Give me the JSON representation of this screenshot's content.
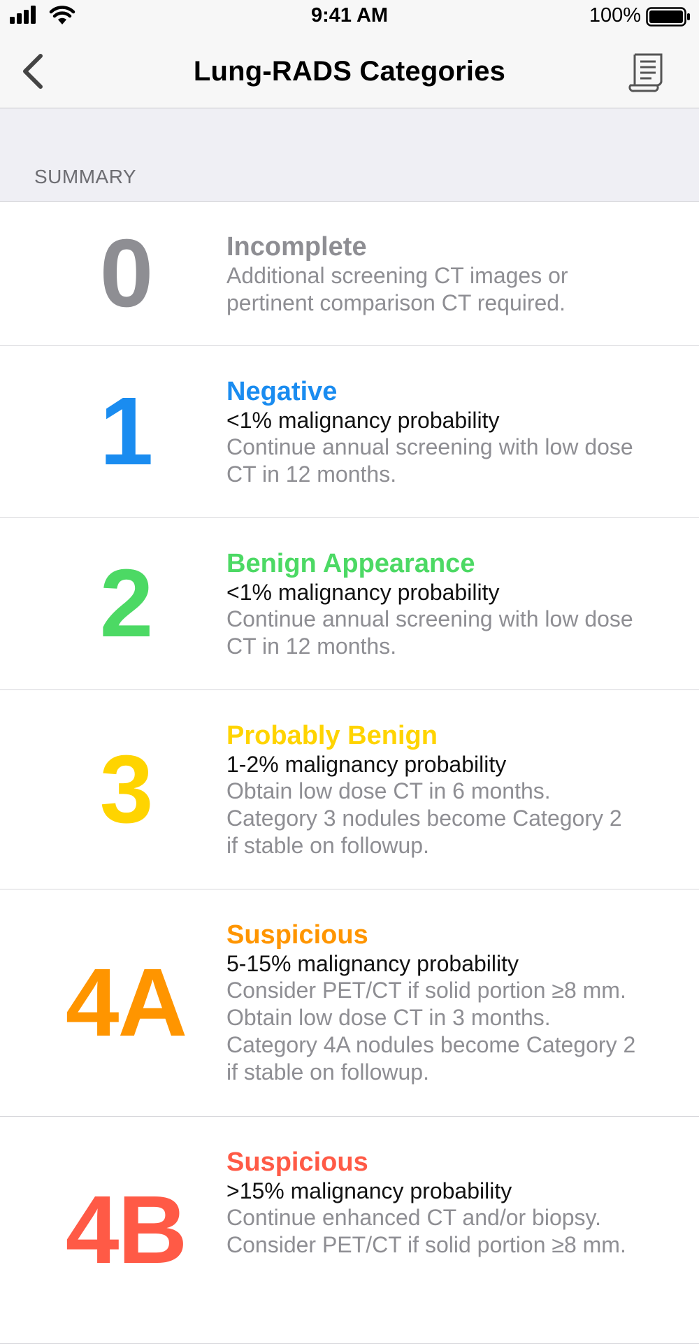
{
  "status_bar": {
    "time": "9:41 AM",
    "battery": "100%"
  },
  "nav": {
    "title": "Lung-RADS Categories"
  },
  "section": {
    "label": "SUMMARY"
  },
  "rows": [
    {
      "num": "0",
      "color": "#8e8e93",
      "title": "Incomplete",
      "prob": "",
      "desc": [
        "Additional screening CT images or",
        "pertinent comparison CT required."
      ]
    },
    {
      "num": "1",
      "color": "#1a8cf0",
      "title": "Negative",
      "prob": "<1% malignancy probability",
      "desc": [
        "Continue annual screening with low dose",
        "CT in 12 months."
      ]
    },
    {
      "num": "2",
      "color": "#4cd964",
      "title": "Benign Appearance",
      "prob": "<1% malignancy probability",
      "desc": [
        "Continue annual screening with low dose",
        "CT in 12 months."
      ]
    },
    {
      "num": "3",
      "color": "#ffd400",
      "title": "Probably Benign",
      "prob": "1-2% malignancy probability",
      "desc": [
        "Obtain low dose CT in 6 months.",
        "Category 3 nodules become Category 2",
        "if stable on followup."
      ]
    },
    {
      "num": "4A",
      "color": "#ff9500",
      "title": "Suspicious",
      "prob": "5-15% malignancy probability",
      "desc": [
        "Consider PET/CT if solid portion ≥8 mm.",
        "Obtain low dose CT in 3 months.",
        "Category 4A nodules become Category 2",
        "if stable on followup."
      ]
    },
    {
      "num": "4B",
      "color": "#ff5a46",
      "title": "Suspicious",
      "prob": ">15% malignancy probability",
      "desc": [
        "Continue enhanced CT and/or biopsy.",
        "Consider PET/CT if solid portion ≥8 mm."
      ]
    }
  ]
}
